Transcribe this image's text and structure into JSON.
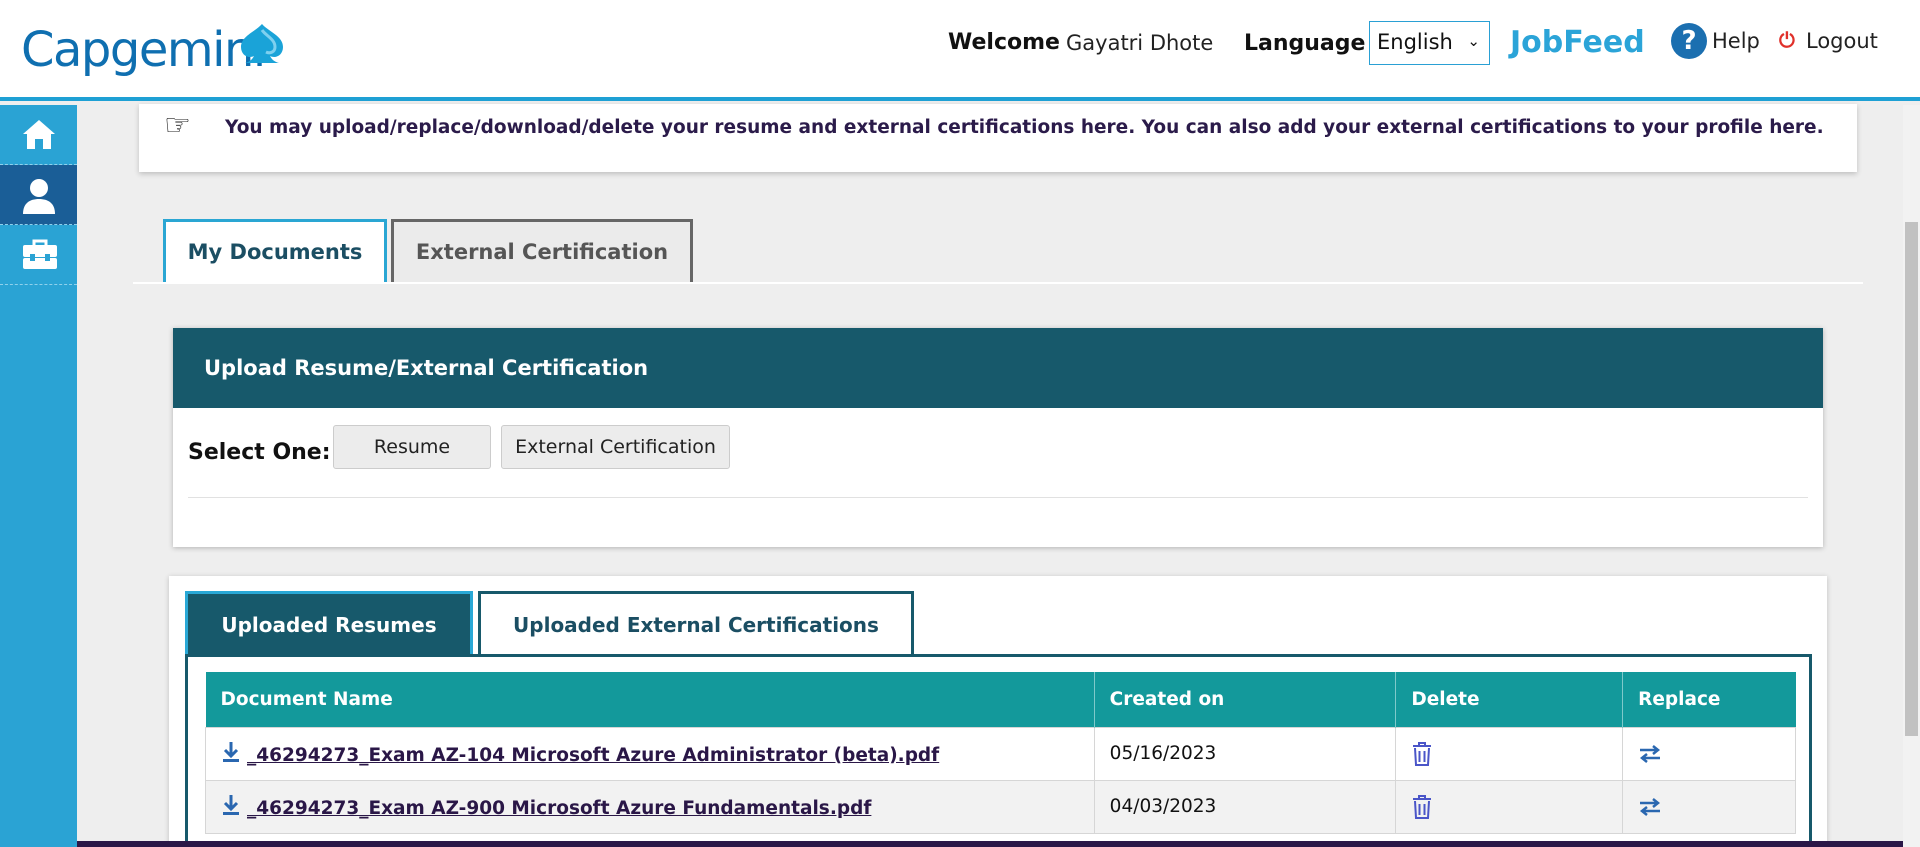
{
  "header": {
    "brand": "Capgemini",
    "welcome_label": "Welcome",
    "user_name": "Gayatri Dhote",
    "language_label": "Language",
    "language_value": "English",
    "jobfeed": "JobFeed",
    "help": "Help",
    "logout": "Logout"
  },
  "sidebar": {
    "items": [
      {
        "name": "home",
        "icon": "home-icon",
        "active": false
      },
      {
        "name": "profile",
        "icon": "user-icon",
        "active": true
      },
      {
        "name": "toolbox",
        "icon": "toolbox-icon",
        "active": false
      }
    ]
  },
  "banner": {
    "icon": "pointing-hand-icon",
    "text": "You may upload/replace/download/delete your resume and external certifications here.  You can also add your external certifications to your profile here."
  },
  "tabs": [
    {
      "label": "My Documents",
      "active": true
    },
    {
      "label": "External Certification",
      "active": false
    }
  ],
  "upload": {
    "title": "Upload Resume/External Certification",
    "select_label": "Select One:",
    "options": [
      "Resume",
      "External Certification"
    ]
  },
  "uploaded": {
    "tabs": [
      {
        "label": "Uploaded Resumes",
        "active": true
      },
      {
        "label": "Uploaded External Certifications",
        "active": false
      }
    ],
    "columns": [
      "Document Name",
      "Created on",
      "Delete",
      "Replace"
    ],
    "rows": [
      {
        "name": "_46294273_Exam AZ-104 Microsoft Azure Administrator (beta).pdf",
        "created": "05/16/2023"
      },
      {
        "name": "_46294273_Exam AZ-900 Microsoft Azure Fundamentals.pdf",
        "created": "04/03/2023"
      }
    ]
  },
  "colors": {
    "accent": "#2aa3d4",
    "header_teal": "#17596b",
    "table_header": "#13999b",
    "brand_blue": "#0f6fb0",
    "logout_red": "#e0302a"
  }
}
